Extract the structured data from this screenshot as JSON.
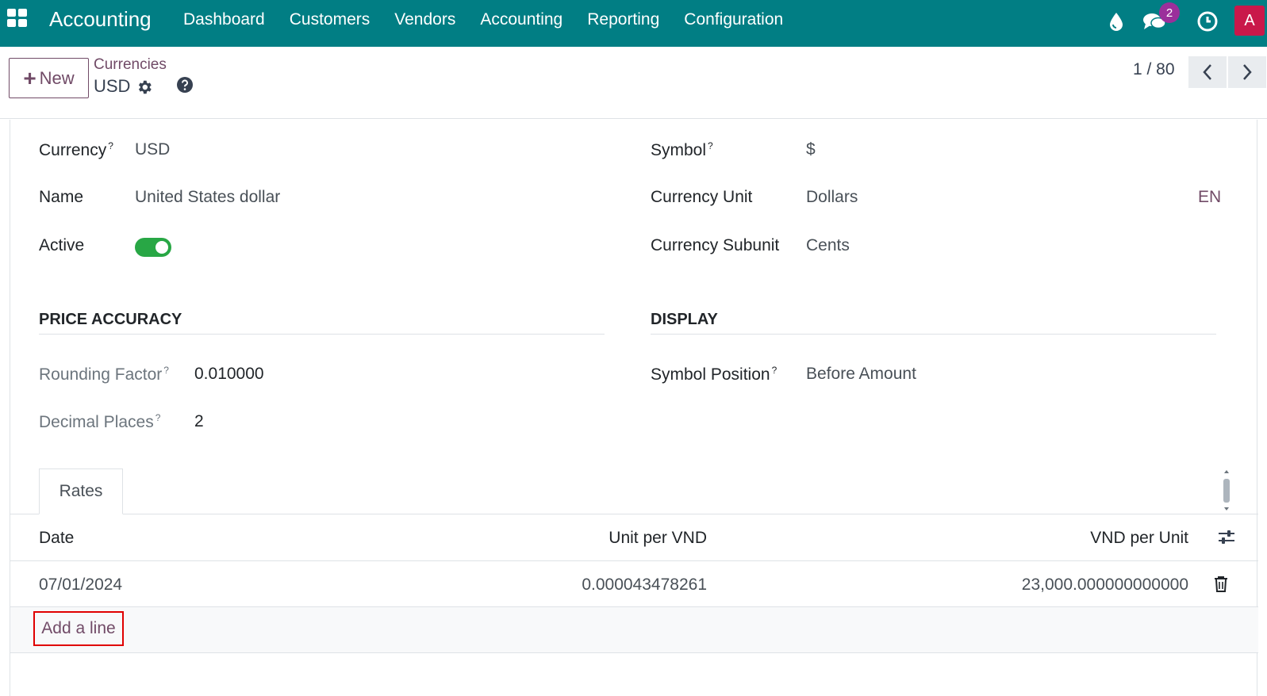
{
  "navbar": {
    "app_title": "Accounting",
    "menu": [
      "Dashboard",
      "Customers",
      "Vendors",
      "Accounting",
      "Reporting",
      "Configuration"
    ],
    "messages_badge": "2",
    "avatar_letter": "A",
    "icons": [
      "apps-grid-icon",
      "drop-icon",
      "chat-icon",
      "clock-icon"
    ],
    "color": "#017e84"
  },
  "control_panel": {
    "new_label": "New",
    "breadcrumb": "Currencies",
    "record": "USD",
    "pager": "1 / 80"
  },
  "form": {
    "currency_label": "Currency",
    "currency_value": "USD",
    "name_label": "Name",
    "name_value": "United States dollar",
    "active_label": "Active",
    "active": true,
    "symbol_label": "Symbol",
    "symbol_value": "$",
    "unit_label": "Currency Unit",
    "unit_value": "Dollars",
    "unit_lang": "EN",
    "subunit_label": "Currency Subunit",
    "subunit_value": "Cents",
    "sup_mark": "?"
  },
  "price_accuracy": {
    "title": "PRICE ACCURACY",
    "rounding_label": "Rounding Factor",
    "rounding_value": "0.010000",
    "decimal_label": "Decimal Places",
    "decimal_value": "2"
  },
  "display": {
    "title": "DISPLAY",
    "position_label": "Symbol Position",
    "position_value": "Before Amount"
  },
  "tabs": [
    "Rates"
  ],
  "rates_table": {
    "columns": [
      "Date",
      "Unit per VND",
      "VND per Unit"
    ],
    "rows": [
      {
        "date": "07/01/2024",
        "unit_per": "0.000043478261",
        "per_unit": "23,000.000000000000"
      }
    ],
    "add_line": "Add a line"
  }
}
